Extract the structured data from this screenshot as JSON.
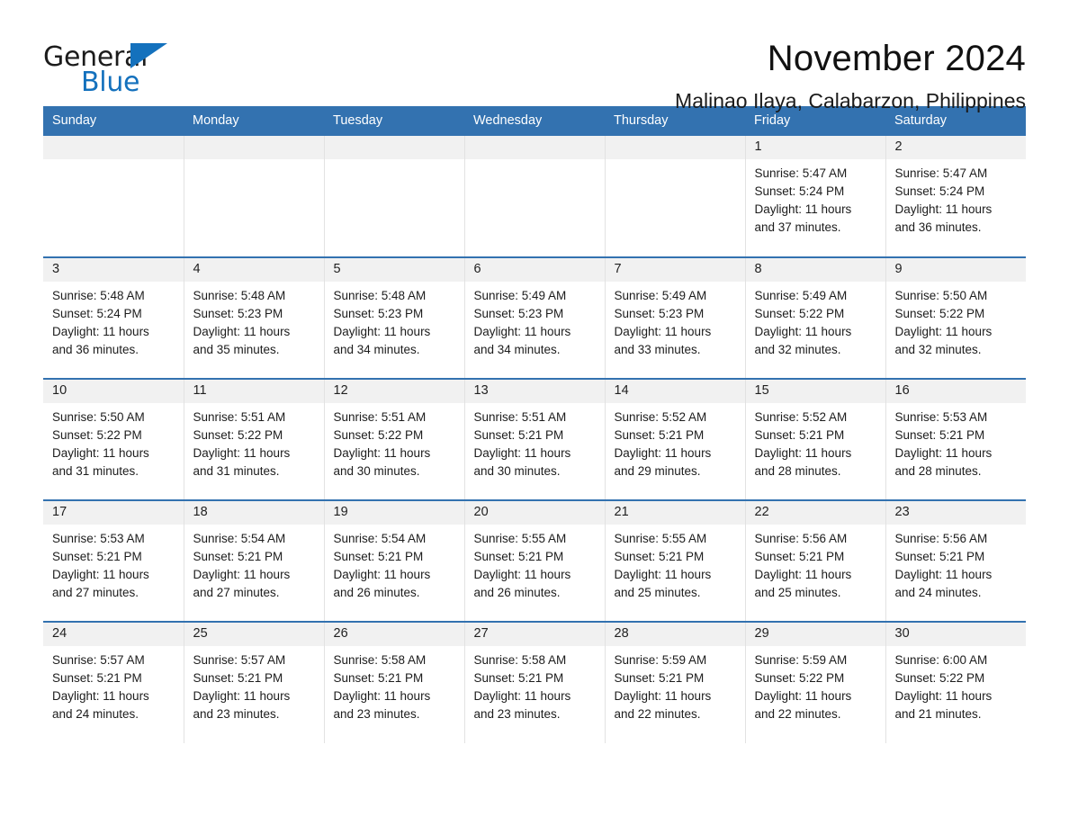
{
  "brand": {
    "name_part1": "General",
    "name_part2": "Blue",
    "flag_icon": "triangle-flag-icon"
  },
  "header": {
    "month_title": "November 2024",
    "location": "Malinao Ilaya, Calabarzon, Philippines"
  },
  "theme": {
    "header_blue": "#3372b0",
    "brand_blue": "#1471bd",
    "daynum_band": "#f1f1f1",
    "page_background": "#ffffff"
  },
  "calendar": {
    "weekday_headers": [
      "Sunday",
      "Monday",
      "Tuesday",
      "Wednesday",
      "Thursday",
      "Friday",
      "Saturday"
    ],
    "weeks": [
      [
        {
          "day": "",
          "lines": []
        },
        {
          "day": "",
          "lines": []
        },
        {
          "day": "",
          "lines": []
        },
        {
          "day": "",
          "lines": []
        },
        {
          "day": "",
          "lines": []
        },
        {
          "day": "1",
          "lines": [
            "Sunrise: 5:47 AM",
            "Sunset: 5:24 PM",
            "Daylight: 11 hours",
            "and 37 minutes."
          ]
        },
        {
          "day": "2",
          "lines": [
            "Sunrise: 5:47 AM",
            "Sunset: 5:24 PM",
            "Daylight: 11 hours",
            "and 36 minutes."
          ]
        }
      ],
      [
        {
          "day": "3",
          "lines": [
            "Sunrise: 5:48 AM",
            "Sunset: 5:24 PM",
            "Daylight: 11 hours",
            "and 36 minutes."
          ]
        },
        {
          "day": "4",
          "lines": [
            "Sunrise: 5:48 AM",
            "Sunset: 5:23 PM",
            "Daylight: 11 hours",
            "and 35 minutes."
          ]
        },
        {
          "day": "5",
          "lines": [
            "Sunrise: 5:48 AM",
            "Sunset: 5:23 PM",
            "Daylight: 11 hours",
            "and 34 minutes."
          ]
        },
        {
          "day": "6",
          "lines": [
            "Sunrise: 5:49 AM",
            "Sunset: 5:23 PM",
            "Daylight: 11 hours",
            "and 34 minutes."
          ]
        },
        {
          "day": "7",
          "lines": [
            "Sunrise: 5:49 AM",
            "Sunset: 5:23 PM",
            "Daylight: 11 hours",
            "and 33 minutes."
          ]
        },
        {
          "day": "8",
          "lines": [
            "Sunrise: 5:49 AM",
            "Sunset: 5:22 PM",
            "Daylight: 11 hours",
            "and 32 minutes."
          ]
        },
        {
          "day": "9",
          "lines": [
            "Sunrise: 5:50 AM",
            "Sunset: 5:22 PM",
            "Daylight: 11 hours",
            "and 32 minutes."
          ]
        }
      ],
      [
        {
          "day": "10",
          "lines": [
            "Sunrise: 5:50 AM",
            "Sunset: 5:22 PM",
            "Daylight: 11 hours",
            "and 31 minutes."
          ]
        },
        {
          "day": "11",
          "lines": [
            "Sunrise: 5:51 AM",
            "Sunset: 5:22 PM",
            "Daylight: 11 hours",
            "and 31 minutes."
          ]
        },
        {
          "day": "12",
          "lines": [
            "Sunrise: 5:51 AM",
            "Sunset: 5:22 PM",
            "Daylight: 11 hours",
            "and 30 minutes."
          ]
        },
        {
          "day": "13",
          "lines": [
            "Sunrise: 5:51 AM",
            "Sunset: 5:21 PM",
            "Daylight: 11 hours",
            "and 30 minutes."
          ]
        },
        {
          "day": "14",
          "lines": [
            "Sunrise: 5:52 AM",
            "Sunset: 5:21 PM",
            "Daylight: 11 hours",
            "and 29 minutes."
          ]
        },
        {
          "day": "15",
          "lines": [
            "Sunrise: 5:52 AM",
            "Sunset: 5:21 PM",
            "Daylight: 11 hours",
            "and 28 minutes."
          ]
        },
        {
          "day": "16",
          "lines": [
            "Sunrise: 5:53 AM",
            "Sunset: 5:21 PM",
            "Daylight: 11 hours",
            "and 28 minutes."
          ]
        }
      ],
      [
        {
          "day": "17",
          "lines": [
            "Sunrise: 5:53 AM",
            "Sunset: 5:21 PM",
            "Daylight: 11 hours",
            "and 27 minutes."
          ]
        },
        {
          "day": "18",
          "lines": [
            "Sunrise: 5:54 AM",
            "Sunset: 5:21 PM",
            "Daylight: 11 hours",
            "and 27 minutes."
          ]
        },
        {
          "day": "19",
          "lines": [
            "Sunrise: 5:54 AM",
            "Sunset: 5:21 PM",
            "Daylight: 11 hours",
            "and 26 minutes."
          ]
        },
        {
          "day": "20",
          "lines": [
            "Sunrise: 5:55 AM",
            "Sunset: 5:21 PM",
            "Daylight: 11 hours",
            "and 26 minutes."
          ]
        },
        {
          "day": "21",
          "lines": [
            "Sunrise: 5:55 AM",
            "Sunset: 5:21 PM",
            "Daylight: 11 hours",
            "and 25 minutes."
          ]
        },
        {
          "day": "22",
          "lines": [
            "Sunrise: 5:56 AM",
            "Sunset: 5:21 PM",
            "Daylight: 11 hours",
            "and 25 minutes."
          ]
        },
        {
          "day": "23",
          "lines": [
            "Sunrise: 5:56 AM",
            "Sunset: 5:21 PM",
            "Daylight: 11 hours",
            "and 24 minutes."
          ]
        }
      ],
      [
        {
          "day": "24",
          "lines": [
            "Sunrise: 5:57 AM",
            "Sunset: 5:21 PM",
            "Daylight: 11 hours",
            "and 24 minutes."
          ]
        },
        {
          "day": "25",
          "lines": [
            "Sunrise: 5:57 AM",
            "Sunset: 5:21 PM",
            "Daylight: 11 hours",
            "and 23 minutes."
          ]
        },
        {
          "day": "26",
          "lines": [
            "Sunrise: 5:58 AM",
            "Sunset: 5:21 PM",
            "Daylight: 11 hours",
            "and 23 minutes."
          ]
        },
        {
          "day": "27",
          "lines": [
            "Sunrise: 5:58 AM",
            "Sunset: 5:21 PM",
            "Daylight: 11 hours",
            "and 23 minutes."
          ]
        },
        {
          "day": "28",
          "lines": [
            "Sunrise: 5:59 AM",
            "Sunset: 5:21 PM",
            "Daylight: 11 hours",
            "and 22 minutes."
          ]
        },
        {
          "day": "29",
          "lines": [
            "Sunrise: 5:59 AM",
            "Sunset: 5:22 PM",
            "Daylight: 11 hours",
            "and 22 minutes."
          ]
        },
        {
          "day": "30",
          "lines": [
            "Sunrise: 6:00 AM",
            "Sunset: 5:22 PM",
            "Daylight: 11 hours",
            "and 21 minutes."
          ]
        }
      ]
    ]
  }
}
